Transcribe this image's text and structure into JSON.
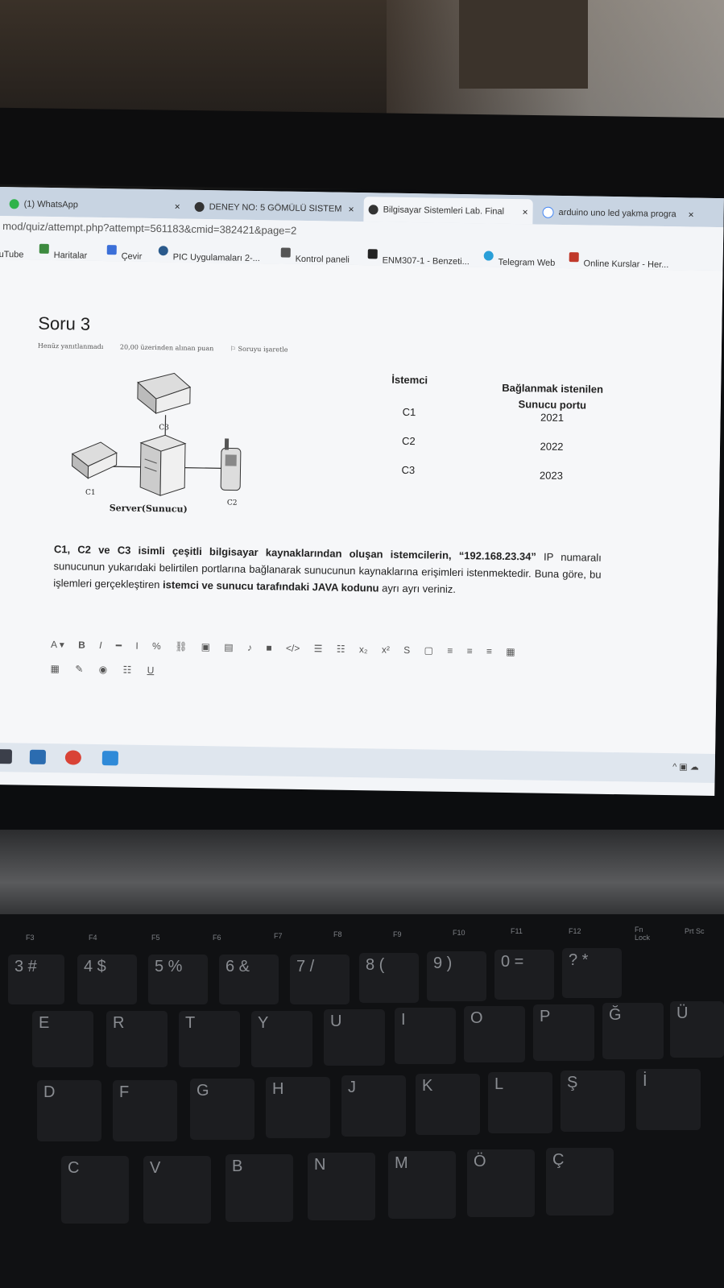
{
  "browser": {
    "tabs": [
      {
        "label": "(1) WhatsApp",
        "icon": "whatsapp-icon",
        "close": "×"
      },
      {
        "label": "DENEY NO: 5 GÖMÜLÜ SISTEM",
        "icon": "moodle-icon",
        "close": "×"
      },
      {
        "label": "Bilgisayar Sistemleri Lab. Final",
        "icon": "moodle-icon",
        "close": "×"
      },
      {
        "label": "arduino uno led yakma progra",
        "icon": "google-icon",
        "close": "×"
      }
    ],
    "url": "mod/quiz/attempt.php?attempt=561183&cmid=382421&page=2",
    "bookmarks": [
      {
        "label": "uTube",
        "icon": "youtube-icon"
      },
      {
        "label": "Haritalar",
        "icon": "maps-icon"
      },
      {
        "label": "Çevir",
        "icon": "translate-icon"
      },
      {
        "label": "PIC Uygulamaları 2-...",
        "icon": "wordpress-icon"
      },
      {
        "label": "Kontrol paneli",
        "icon": "control-panel-icon"
      },
      {
        "label": "ENM307-1 - Benzeti...",
        "icon": "course-icon"
      },
      {
        "label": "Telegram Web",
        "icon": "telegram-icon"
      },
      {
        "label": "Online Kurslar - Her...",
        "icon": "udemy-icon"
      }
    ]
  },
  "question": {
    "title": "Soru 3",
    "status": "Henüz yanıtlanmadı",
    "points": "20,00 üzerinden alınan puan",
    "flag": "Soruyu işaretle",
    "diagram_labels": {
      "c1": "C1",
      "c2": "C2",
      "c3": "C3",
      "server": "Server(Sunucu)"
    },
    "table": {
      "header_client": "İstemci",
      "header_port_line1": "Bağlanmak istenilen",
      "header_port_line2": "Sunucu portu",
      "rows": [
        {
          "client": "C1",
          "port": "2021"
        },
        {
          "client": "C2",
          "port": "2022"
        },
        {
          "client": "C3",
          "port": "2023"
        }
      ]
    },
    "text_part1": "C1, C2 ve C3 isimli çeşitli bilgisayar kaynaklarından oluşan istemcilerin, “192.168.23.34”",
    "text_part2": " IP numaralı sunucunun yukarıdaki belirtilen portlarına bağlanarak sunucunun kaynaklarına erişimleri istenmektedir. Buna göre, bu işlemleri gerçekleştiren ",
    "text_part3": "istemci ve sunucu tarafındaki JAVA kodunu",
    "text_part4": " ayrı ayrı veriniz."
  },
  "editor_toolbar": {
    "row1": [
      "A ▾",
      "B",
      "I",
      "━",
      "I",
      "%",
      "⛓",
      "▣",
      "▤",
      "♪",
      "■",
      "</>",
      "☰",
      "☷",
      "x₂",
      "x²",
      "S",
      "▢",
      "≡",
      "≡",
      "≡",
      "▦"
    ],
    "row2": [
      "▦",
      "✎",
      "◉",
      "☷",
      "U"
    ]
  },
  "taskbar": {
    "apps": [
      "store-icon",
      "mail-icon",
      "chrome-icon",
      "files-icon"
    ],
    "tray": "^ ▣ ☁"
  },
  "keyboard": {
    "fkeys": [
      "F3",
      "F4",
      "F5",
      "F6",
      "F7",
      "F8",
      "F9",
      "F10",
      "F11",
      "F12",
      "Fn Lock",
      "Prt Sc"
    ],
    "row_numbers": [
      "3 #",
      "4 $",
      "5 %",
      "6 &",
      "7 /",
      "8 (",
      "9 )",
      "0 =",
      "? *"
    ],
    "row_top": [
      "E",
      "R",
      "T",
      "Y",
      "U",
      "I",
      "O",
      "P",
      "Ğ",
      "Ü"
    ],
    "row_mid": [
      "D",
      "F",
      "G",
      "H",
      "J",
      "K",
      "L",
      "Ş",
      "İ"
    ],
    "row_bottom": [
      "C",
      "V",
      "B",
      "N",
      "M",
      "Ö",
      "Ç"
    ]
  }
}
